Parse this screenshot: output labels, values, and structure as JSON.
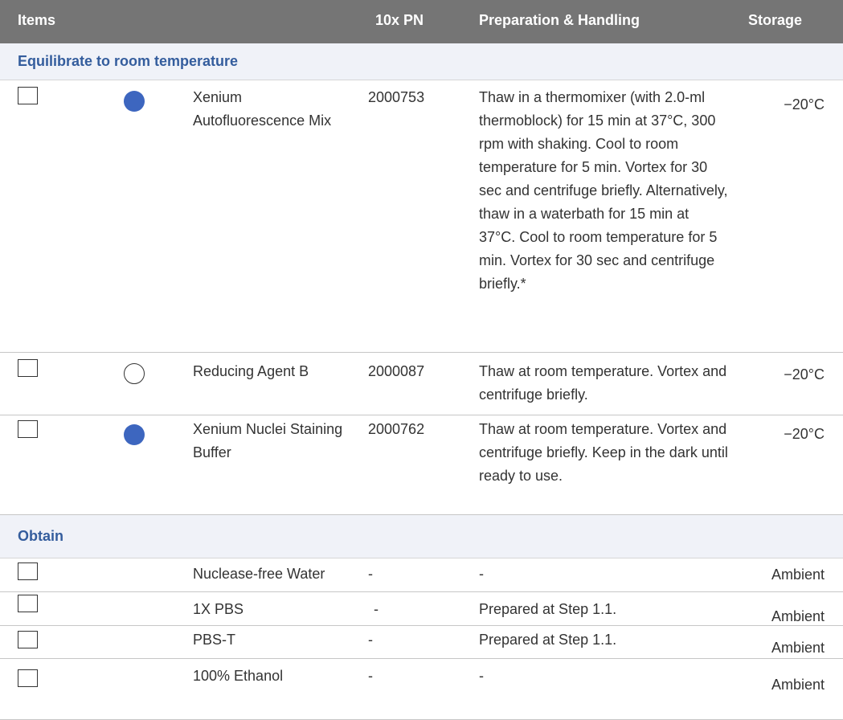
{
  "header": {
    "items": "Items",
    "pn": "10x PN",
    "prep": "Preparation & Handling",
    "storage": "Storage"
  },
  "sections": [
    {
      "title": "Equilibrate to room temperature",
      "rows": [
        {
          "indicator": "filled-circle",
          "name": "Xenium Autofluorescence Mix",
          "pn": "2000753",
          "prep": "Thaw in a thermomixer (with 2.0-ml thermoblock) for 15 min at 37°C, 300 rpm with shaking. Cool to room temperature for 5 min. Vortex for 30 sec and centrifuge briefly. Alternatively, thaw in a waterbath for 15 min at 37°C. Cool to room temperature for 5 min. Vortex for 30 sec and centrifuge briefly.*",
          "storage": "−20°C"
        },
        {
          "indicator": "hollow-circle",
          "name": "Reducing Agent B",
          "pn": "2000087",
          "prep": "Thaw at room temperature. Vortex and centrifuge briefly.",
          "storage": "−20°C"
        },
        {
          "indicator": "filled-circle",
          "name": "Xenium Nuclei Staining Buffer",
          "pn": "2000762",
          "prep": "Thaw at room temperature. Vortex and centrifuge briefly. Keep in the dark until ready to use.",
          "storage": "−20°C"
        }
      ]
    },
    {
      "title": "Obtain",
      "rows": [
        {
          "name": "Nuclease-free Water",
          "pn": "-",
          "prep": "-",
          "storage": "Ambient"
        },
        {
          "name": "1X PBS",
          "pn": "-",
          "prep": "Prepared at Step 1.1.",
          "storage": "Ambient"
        },
        {
          "name": "PBS-T",
          "pn": "-",
          "prep": "Prepared at Step 1.1.",
          "storage": "Ambient"
        },
        {
          "name": "100% Ethanol",
          "pn": "-",
          "prep": "-",
          "storage": "Ambient"
        }
      ]
    }
  ],
  "colors": {
    "header_bg": "#757575",
    "section_bg": "#f0f2f8",
    "section_text": "#345d9d",
    "indicator_fill": "#3d66bf"
  }
}
